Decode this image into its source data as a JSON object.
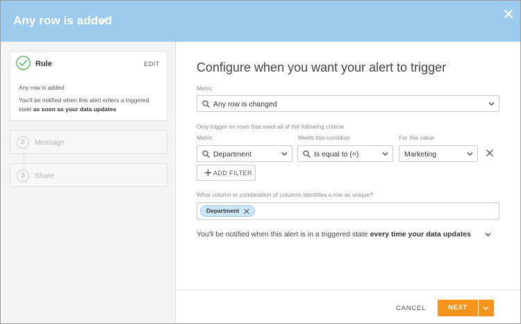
{
  "dialog": {
    "title": "Any row is added"
  },
  "steps": [
    {
      "label": "Rule",
      "edit_label": "EDIT",
      "description": "Any row is added",
      "note_prefix": "You'll be notified when this alert enters a triggered state ",
      "note_bold": "as soon as your data updates"
    },
    {
      "number": "2",
      "label": "Message"
    },
    {
      "number": "3",
      "label": "Share"
    }
  ],
  "main": {
    "heading": "Configure when you want your alert to trigger",
    "metric_label": "Metric",
    "metric_value": "Any row is changed",
    "criteria_label": "Only trigger on rows that meet all of the following criteria",
    "filter": {
      "metric_label": "Metric",
      "metric_value": "Department",
      "condition_label": "Meets this condition",
      "condition_value": "Is equal to (=)",
      "value_label": "For this value",
      "value_value": "Marketing"
    },
    "add_filter_label": "ADD FILTER",
    "unique_label": "What column or combination of columns identifies a row as unique?",
    "unique_tags": [
      "Department"
    ],
    "notify_prefix": "You'll be notified when this alert is in a triggered state ",
    "notify_bold": "every time your data updates"
  },
  "footer": {
    "cancel_label": "CANCEL",
    "next_label": "NEXT"
  },
  "colors": {
    "header": "#9ccbee",
    "accent": "#f7941d",
    "check": "#5cb85c",
    "tag": "#cce5f7"
  }
}
